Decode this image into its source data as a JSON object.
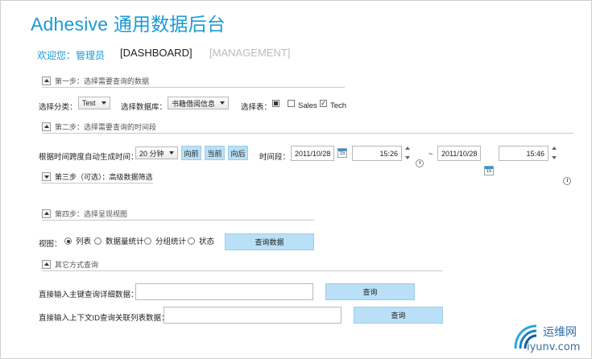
{
  "header": {
    "app_name": "Adhesive",
    "title_cn": "通用数据后台",
    "welcome": "欢迎您：管理员",
    "nav_dashboard": "[DASHBOARD]",
    "nav_management": "[MANAGEMENT]"
  },
  "step1": {
    "title": "第一步：选择需要查询的数据",
    "category_label": "选择分类：",
    "category_value": "Test",
    "database_label": "选择数据库：",
    "database_value": "书籍借阅信息",
    "table_label": "选择表：",
    "tables": [
      {
        "label": "",
        "checked": "filled"
      },
      {
        "label": "Sales",
        "checked": "false"
      },
      {
        "label": "Tech",
        "checked": "true"
      }
    ]
  },
  "step2": {
    "title": "第二步：选择需要查询的时间段",
    "auto_label": "根据时间跨度自动生成时间：",
    "span_value": "20 分钟",
    "btn_prev": "向前",
    "btn_now": "当前",
    "btn_next": "向后",
    "range_label": "时间段：",
    "start_date": "2011/10/28",
    "start_time": "15:26",
    "tilde": "~",
    "end_date": "2011/10/28",
    "end_time": "15:46",
    "calendar_day": "15"
  },
  "step3": {
    "title": "第三步（可选）：高级数据筛选"
  },
  "step4": {
    "title": "第四步：选择呈现视图",
    "view_label": "视图：",
    "views": [
      {
        "label": "列表",
        "selected": true
      },
      {
        "label": "数据量统计",
        "selected": false
      },
      {
        "label": "分组统计",
        "selected": false
      },
      {
        "label": "状态",
        "selected": false
      }
    ],
    "query_btn": "查询数据"
  },
  "other": {
    "title": "其它方式查询",
    "pk_label": "直接输入主键查询详细数据：",
    "pk_value": "",
    "pk_btn": "查询",
    "ctx_label": "直接输入上下文ID查询关联列表数据：",
    "ctx_value": "",
    "ctx_btn": "查询"
  },
  "watermark": {
    "text": "运维网",
    "url": "iyunv.com"
  },
  "colors": {
    "accent": "#1a9ad6",
    "button": "#b9e0f6",
    "muted": "#bcbcbc"
  }
}
